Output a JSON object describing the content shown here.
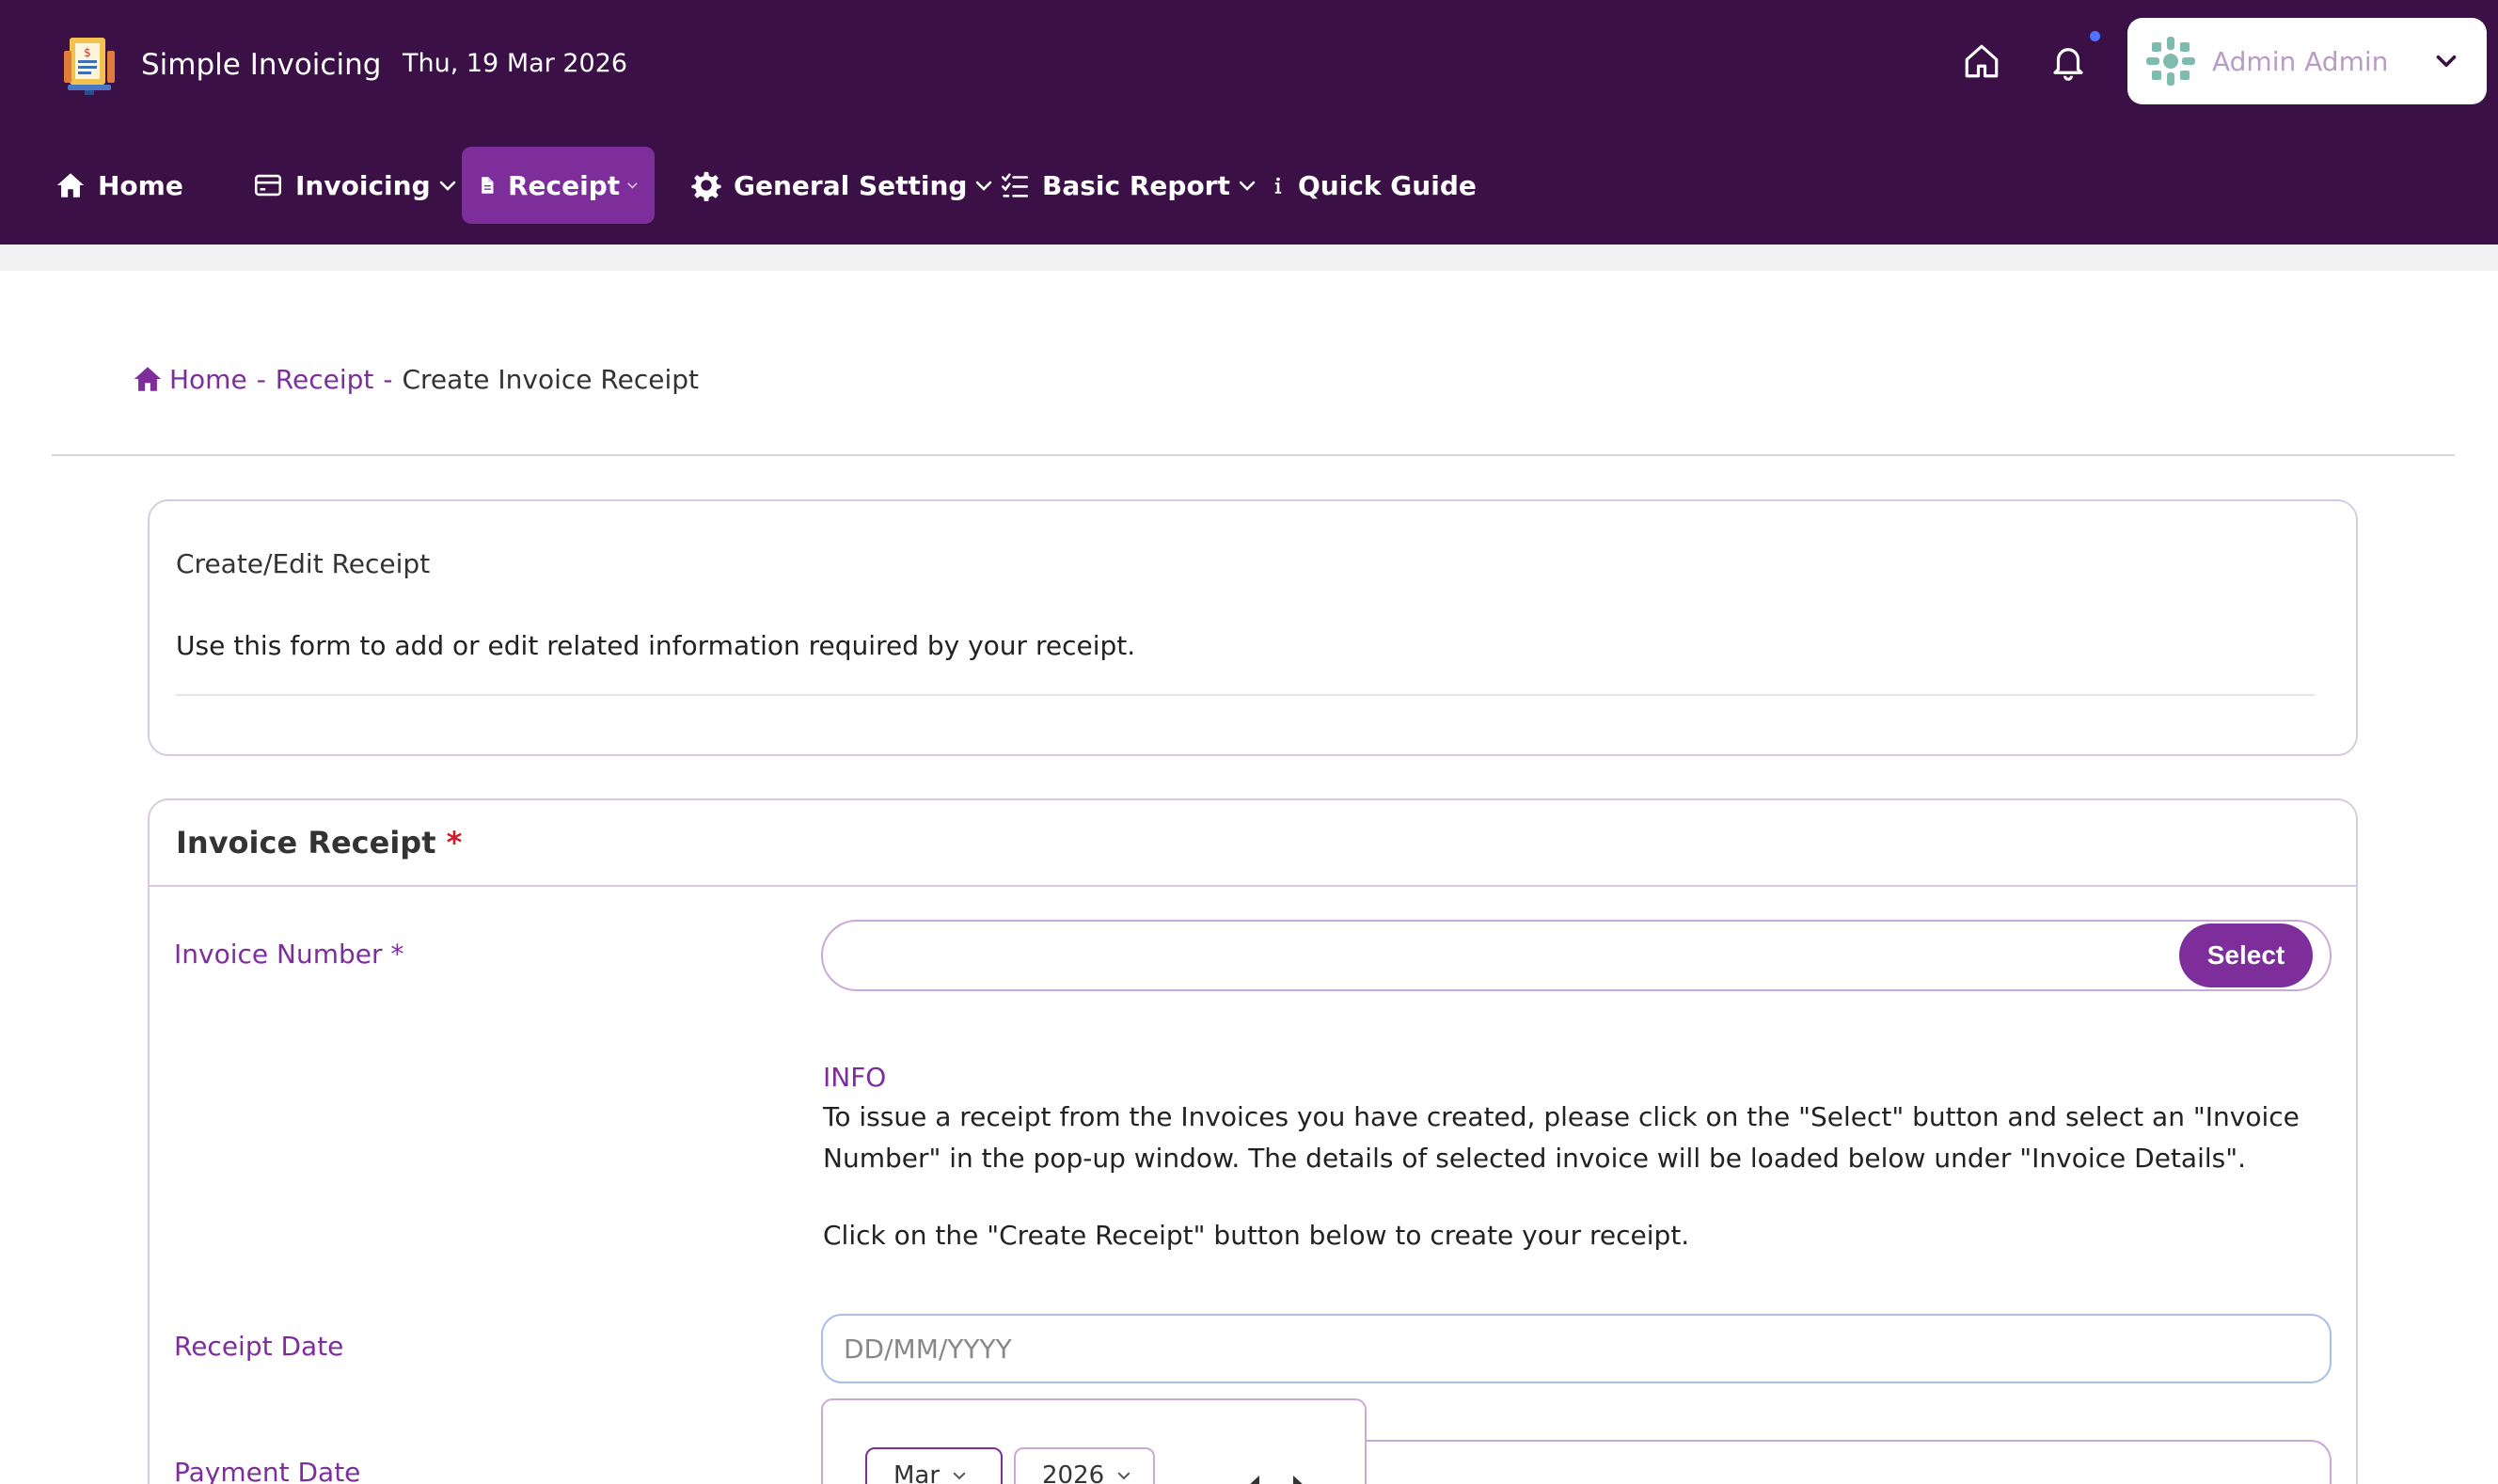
{
  "header": {
    "app_name": "Simple Invoicing",
    "date": "Thu, 19 Mar 2026",
    "user_name": "Admin Admin"
  },
  "nav": {
    "home": "Home",
    "invoicing": "Invoicing",
    "receipt": "Receipt",
    "general_setting": "General Setting",
    "basic_report": "Basic Report",
    "quick_guide": "Quick Guide"
  },
  "breadcrumb": {
    "home": "Home",
    "sep1": "-",
    "receipt": "Receipt",
    "sep2": "-",
    "current": "Create Invoice Receipt"
  },
  "intro_card": {
    "title": "Create/Edit Receipt",
    "description": "Use this form to add or edit related information required by your receipt."
  },
  "form": {
    "section_title": "Invoice Receipt",
    "required_mark": "*",
    "invoice_number_label": "Invoice Number",
    "invoice_number_value": "",
    "select_button": "Select",
    "info_title": "INFO",
    "info_text": "To issue a receipt from the Invoices you have created, please click on the \"Select\" button and select an \"Invoice Number\" in the pop-up window. The details of selected invoice will be loaded below under \"Invoice Details\".",
    "info_text2": "Click on the \"Create Receipt\" button below to create your receipt.",
    "receipt_date_label": "Receipt Date",
    "receipt_date_placeholder": "DD/MM/YYYY",
    "payment_date_label": "Payment Date"
  },
  "calendar": {
    "month": "Mar",
    "year": "2026"
  },
  "colors": {
    "topbar": "#3b1046",
    "accent": "#7d2e9a",
    "active_nav": "#7d2e9a",
    "required": "#d11a2a"
  }
}
